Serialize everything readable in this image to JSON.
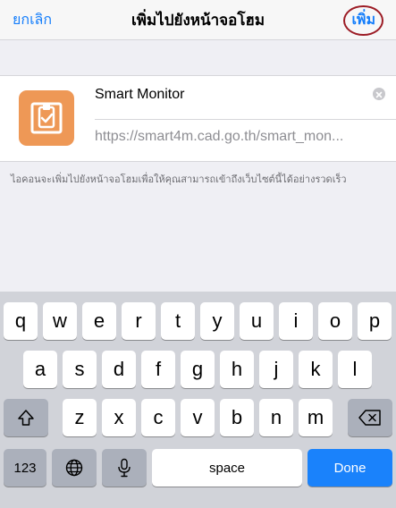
{
  "nav": {
    "cancel_label": "ยกเลิก",
    "title": "เพิ่มไปยังหน้าจอโฮม",
    "add_label": "เพิ่ม"
  },
  "bookmark": {
    "name_value": "Smart Monitor",
    "url_text": "https://smart4m.cad.go.th/smart_mon...",
    "icon_name": "clipboard-check-icon",
    "icon_color": "#ee9856"
  },
  "helper_text": "ไอคอนจะเพิ่มไปยังหน้าจอโฮมเพื่อให้คุณสามารถเข้าถึงเว็บไซต์นี้ได้อย่างรวดเร็ว",
  "keyboard": {
    "row1": [
      "q",
      "w",
      "e",
      "r",
      "t",
      "y",
      "u",
      "i",
      "o",
      "p"
    ],
    "row2": [
      "a",
      "s",
      "d",
      "f",
      "g",
      "h",
      "j",
      "k",
      "l"
    ],
    "row3": [
      "z",
      "x",
      "c",
      "v",
      "b",
      "n",
      "m"
    ],
    "numbers_label": "123",
    "space_label": "space",
    "done_label": "Done",
    "done_color": "#1a82fb"
  }
}
